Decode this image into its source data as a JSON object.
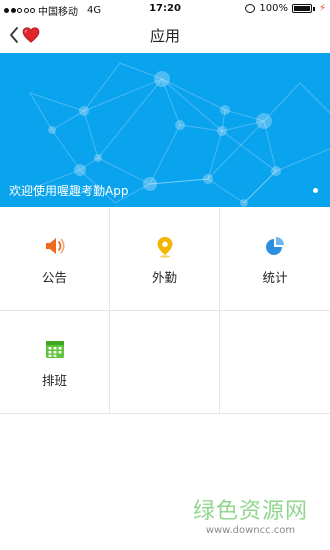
{
  "status_bar": {
    "carrier": "中国移动",
    "network": "4G",
    "time": "17:20",
    "battery": "100%"
  },
  "nav": {
    "title": "应用",
    "back_icon": "chevron-left-icon",
    "favorite_icon": "heart-icon",
    "heart_color": "#e0262b"
  },
  "banner": {
    "caption": "欢迎使用喔趣考勤App",
    "background_color": "#0aa3ee"
  },
  "apps": [
    {
      "label": "公告",
      "icon": "speaker-icon",
      "color": "#f06a1d"
    },
    {
      "label": "外勤",
      "icon": "location-pin-icon",
      "color": "#f5b400"
    },
    {
      "label": "统计",
      "icon": "pie-chart-icon",
      "color": "#2d8fe0"
    },
    {
      "label": "排班",
      "icon": "calendar-icon",
      "color": "#5ec43a"
    }
  ],
  "watermark": {
    "main": "绿色资源网",
    "sub": "www.downcc.com"
  }
}
